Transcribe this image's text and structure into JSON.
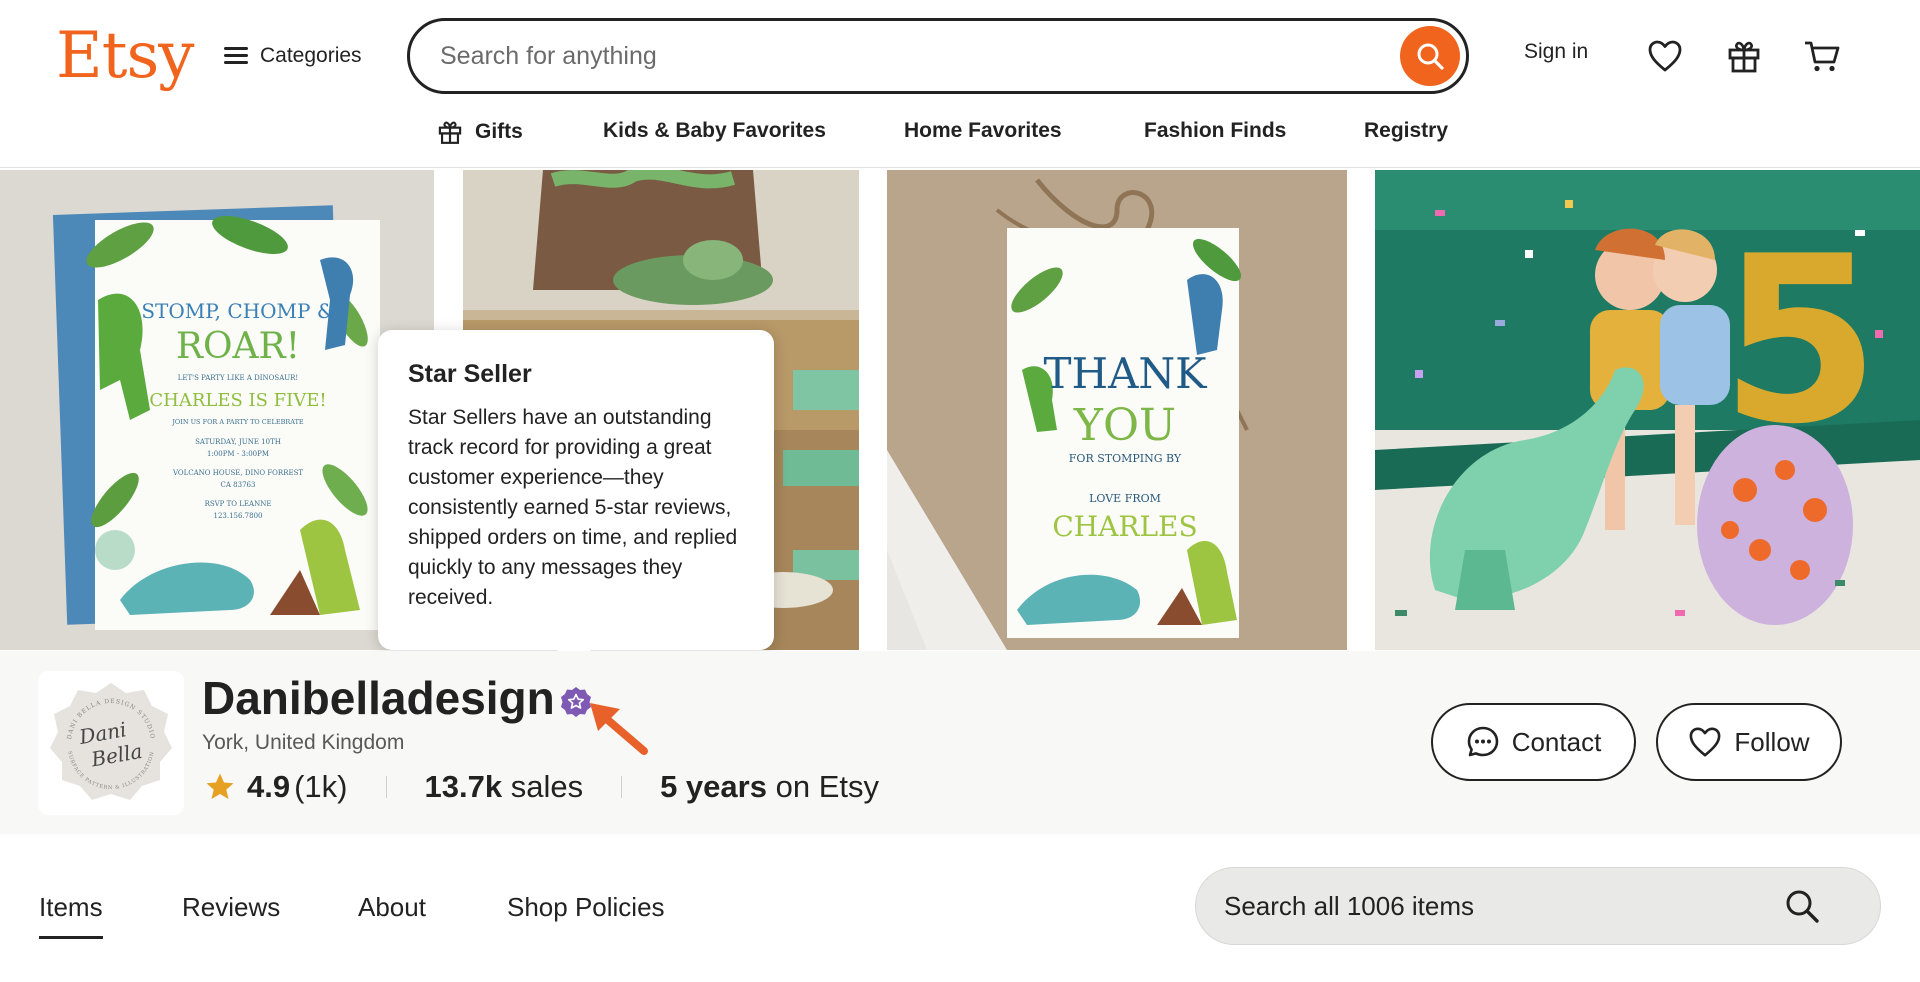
{
  "header": {
    "logo": "Etsy",
    "categories_label": "Categories",
    "search_placeholder": "Search for anything",
    "sign_in_label": "Sign in",
    "accent_color": "#f1641e",
    "icons": [
      "search-icon",
      "heart-icon",
      "gift-icon",
      "cart-icon"
    ]
  },
  "subnav": {
    "items": [
      {
        "label": "Gifts",
        "icon": "gift-icon"
      },
      {
        "label": "Kids & Baby Favorites"
      },
      {
        "label": "Home Favorites"
      },
      {
        "label": "Fashion Finds"
      },
      {
        "label": "Registry"
      }
    ]
  },
  "banner": {
    "invitation": {
      "line1": "STOMP, CHOMP &",
      "line2": "ROAR!",
      "line3": "LET'S PARTY LIKE A DINOSAUR!",
      "line4": "CHARLES IS FIVE!",
      "line5": "JOIN US FOR A PARTY TO CELEBRATE",
      "line6": "SATURDAY, JUNE 10TH",
      "line7": "1:00PM - 3:00PM",
      "line8": "VOLCANO HOUSE, DINO FORREST",
      "line9": "CA 83763",
      "line10": "RSVP TO LEANNE",
      "line11": "123.156.7800"
    },
    "thankyou_tag": {
      "line1": "THANK",
      "line2": "YOU",
      "line3": "FOR STOMPING BY",
      "line4": "LOVE FROM",
      "line5": "CHARLES"
    },
    "balloon_number": "5",
    "carousel": {
      "count": 3,
      "active": 2
    }
  },
  "tooltip": {
    "title": "Star Seller",
    "body": "Star Sellers have an outstanding track record for providing a great customer experience—they consistently earned 5-star reviews, shipped orders on time, and replied quickly to any messages they received."
  },
  "shop": {
    "logo_text_top": "DANI BELLA DESIGN STUDIO",
    "logo_text_main_1": "Dani",
    "logo_text_main_2": "Bella",
    "logo_text_bottom": "SURFACE PATTERN & ILLUSTRATION",
    "name": "Danibelladesign",
    "star_seller_color": "#7f5ab5",
    "location": "York, United Kingdom",
    "rating": "4.9",
    "rating_count": "(1k)",
    "sales_value": "13.7k",
    "sales_label": "sales",
    "years_value": "5 years",
    "years_label": "on Etsy",
    "contact_label": "Contact",
    "follow_label": "Follow"
  },
  "tabs": {
    "items": [
      "Items",
      "Reviews",
      "About",
      "Shop Policies"
    ],
    "active": "Items",
    "search_placeholder": "Search all 1006 items"
  }
}
